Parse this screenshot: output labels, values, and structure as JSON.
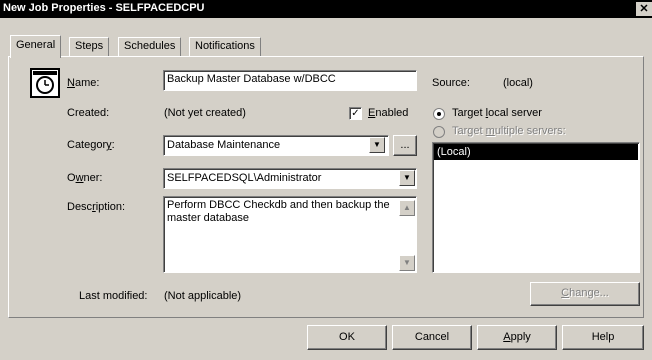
{
  "window": {
    "title": "New Job Properties - SELFPACEDCPU",
    "close_glyph": "✕"
  },
  "tabs": [
    {
      "label": "General",
      "active": true
    },
    {
      "label": "Steps"
    },
    {
      "label": "Schedules"
    },
    {
      "label": "Notifications"
    }
  ],
  "general": {
    "icon": "clock-icon",
    "name_label_u": "N",
    "name_label_rest": "ame:",
    "name_value": "Backup Master Database w/DBCC",
    "created_label": "Created:",
    "created_value": "(Not yet created)",
    "enabled_label_u": "E",
    "enabled_label_rest": "nabled",
    "enabled_checked": "✓",
    "category_label_pre": "Categor",
    "category_label_u": "y",
    "category_label_post": ":",
    "category_value": "Database Maintenance",
    "category_browse": "...",
    "owner_label_pre": "O",
    "owner_label_u": "w",
    "owner_label_post": "ner:",
    "owner_value": "SELFPACEDSQL\\Administrator",
    "description_label_pre": "Desc",
    "description_label_u": "r",
    "description_label_post": "iption:",
    "description_value": "Perform DBCC Checkdb and then backup the master database",
    "last_modified_label": "Last modified:",
    "last_modified_value": "(Not applicable)"
  },
  "source": {
    "label": "Source:",
    "value": "(local)",
    "target_local_pre": "Target ",
    "target_local_u": "l",
    "target_local_post": "ocal server",
    "target_multi_pre": "Target ",
    "target_multi_u": "m",
    "target_multi_post": "ultiple servers:",
    "servers": [
      "(Local)"
    ],
    "change_pre": "",
    "change_u": "C",
    "change_post": "hange..."
  },
  "footer": {
    "ok": "OK",
    "cancel": "Cancel",
    "apply_u": "A",
    "apply_rest": "pply",
    "help": "Help"
  }
}
